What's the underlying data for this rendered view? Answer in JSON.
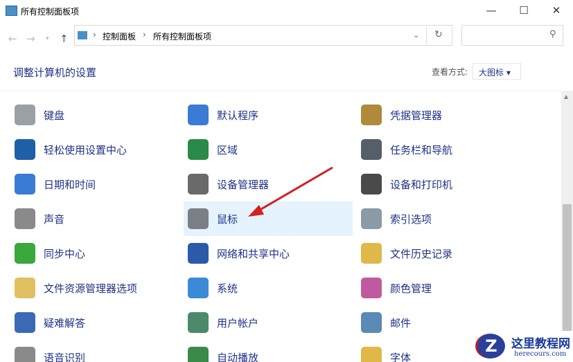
{
  "window": {
    "title": "所有控制面板项"
  },
  "address": {
    "crumbs": [
      "控制面板",
      "所有控制面板项"
    ],
    "search_placeholder": ""
  },
  "header": {
    "title": "调整计算机的设置",
    "view_label": "查看方式:",
    "view_value": "大图标 ▾"
  },
  "items": [
    {
      "label": "键盘",
      "color": "#9aa0a6"
    },
    {
      "label": "默认程序",
      "color": "#3a7bd5"
    },
    {
      "label": "凭据管理器",
      "color": "#b08a3a"
    },
    {
      "label": "轻松使用设置中心",
      "color": "#1e5fa8"
    },
    {
      "label": "区域",
      "color": "#2a8a4a"
    },
    {
      "label": "任务栏和导航",
      "color": "#555f6a"
    },
    {
      "label": "日期和时间",
      "color": "#3a7bd5"
    },
    {
      "label": "设备管理器",
      "color": "#6a6a6a"
    },
    {
      "label": "设备和打印机",
      "color": "#4a4a4a"
    },
    {
      "label": "声音",
      "color": "#8a8a8a"
    },
    {
      "label": "鼠标",
      "color": "#7a7f86"
    },
    {
      "label": "索引选项",
      "color": "#8a9aa6"
    },
    {
      "label": "同步中心",
      "color": "#3aa83a"
    },
    {
      "label": "网络和共享中心",
      "color": "#2a5aa8"
    },
    {
      "label": "文件历史记录",
      "color": "#e0b84a"
    },
    {
      "label": "文件资源管理器选项",
      "color": "#e0c060"
    },
    {
      "label": "系统",
      "color": "#3a8ad5"
    },
    {
      "label": "颜色管理",
      "color": "#c05aa0"
    },
    {
      "label": "疑难解答",
      "color": "#3a6ab5"
    },
    {
      "label": "用户帐户",
      "color": "#4a8a6a"
    },
    {
      "label": "邮件",
      "color": "#5a8ab5"
    },
    {
      "label": "语音识别",
      "color": "#8a8a8a"
    },
    {
      "label": "自动播放",
      "color": "#3a8a4a"
    },
    {
      "label": "字体",
      "color": "#e0b84a"
    }
  ],
  "selected_item": "鼠标",
  "watermark": {
    "name": "这里教程网",
    "url": "herecours.com"
  }
}
